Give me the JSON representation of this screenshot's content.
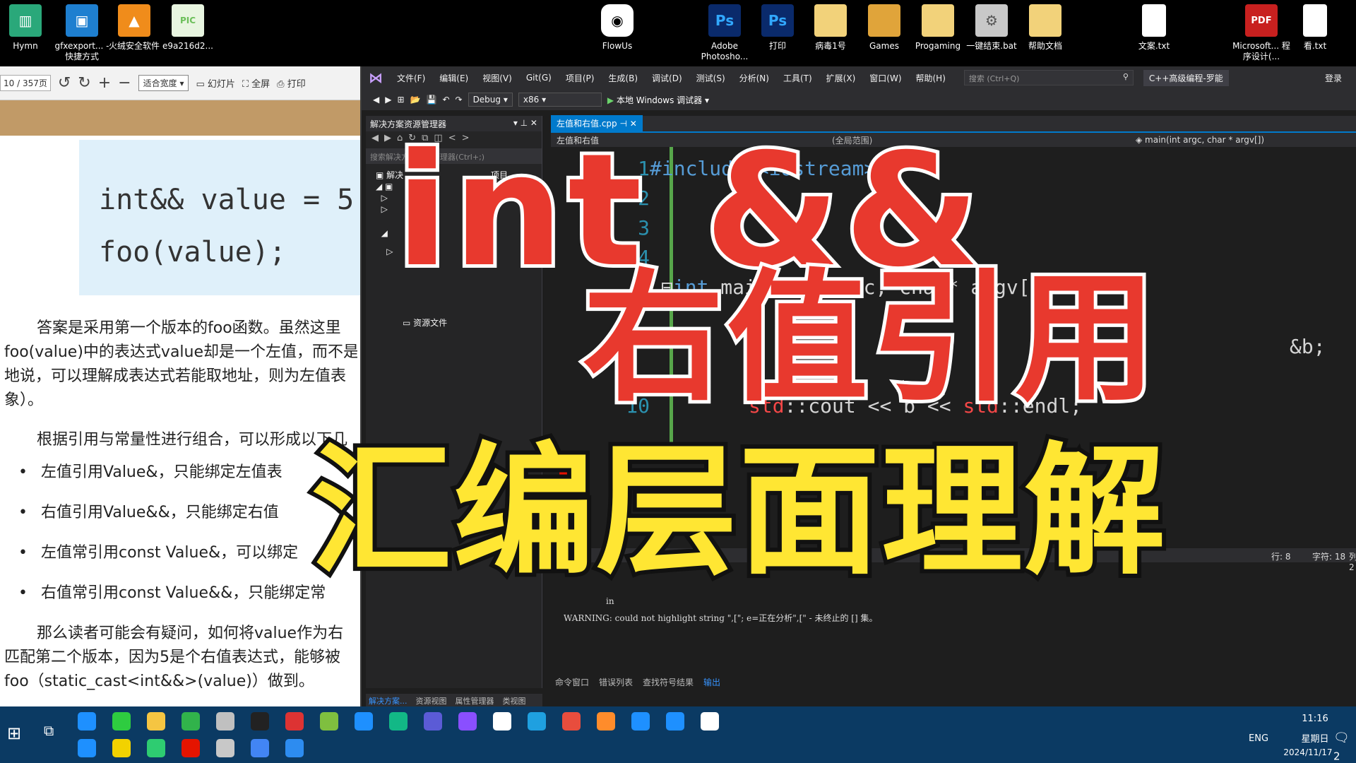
{
  "desktop": {
    "icons": [
      {
        "label": "Hymn",
        "color": "#2aa87a"
      },
      {
        "label": "gfxexport... - 快捷方式",
        "color": "#1e7fd0"
      },
      {
        "label": "火绒安全软件",
        "color": "#f08c1b"
      },
      {
        "label": "e9a216d2...",
        "color": "#6bbf59"
      },
      {
        "label": "FlowUs",
        "color": "#ffffff"
      },
      {
        "label": "Adobe Photosho...",
        "color": "#0a2a6b"
      },
      {
        "label": "打印",
        "color": "#0a2a6b"
      },
      {
        "label": "病毒1号",
        "color": "#f2d27a"
      },
      {
        "label": "Games",
        "color": "#e0a43a"
      },
      {
        "label": "Progaming",
        "color": "#f2d27a"
      },
      {
        "label": "一键结束.bat",
        "color": "#c8c8c8"
      },
      {
        "label": "帮助文档",
        "color": "#f2d27a"
      },
      {
        "label": "文案.txt",
        "color": "#ffffff"
      },
      {
        "label": "Microsoft... 程序设计(...",
        "color": "#c8201f"
      },
      {
        "label": "看.txt",
        "color": "#ffffff"
      }
    ],
    "ps_text": "Ps",
    "pdf_badge": "PDF",
    "pic_badge": "PIC"
  },
  "pdf_reader": {
    "page_indicator": "10 / 357页",
    "zoom": "适合宽度",
    "slideshow": "幻灯片",
    "fullscreen": "全屏",
    "print": "打印",
    "code_line1": "int&& value = 5",
    "code_line2": "foo(value);",
    "para1_l1": "答案是采用第一个版本的foo函数。虽然这里",
    "para1_l2": "foo(value)中的表达式value却是一个左值，而不是",
    "para1_l3": "地说，可以理解成表达式若能取地址，则为左值表",
    "para1_l4": "象）。",
    "para2": "根据引用与常量性进行组合，可以形成以下几",
    "bullets": [
      "左值引用Value&，只能绑定左值表",
      "右值引用Value&&，只能绑定右值",
      "左值常引用const Value&，可以绑定",
      "右值常引用const Value&&，只能绑定常"
    ],
    "para3_l1": "那么读者可能会有疑问，如何将value作为右",
    "para3_l2": "匹配第二个版本，因为5是个右值表达式，能够被",
    "para3_l3": "foo（static_cast<int&&>(value)）做到。"
  },
  "vs": {
    "menus": [
      "文件(F)",
      "编辑(E)",
      "视图(V)",
      "Git(G)",
      "项目(P)",
      "生成(B)",
      "调试(D)",
      "测试(S)",
      "分析(N)",
      "工具(T)",
      "扩展(X)",
      "窗口(W)",
      "帮助(H)"
    ],
    "search_placeholder": "搜索 (Ctrl+Q)",
    "project_title": "C++高级编程-罗能",
    "login": "登录",
    "config": "Debug",
    "platform": "x86",
    "run_label": "本地 Windows 调试器",
    "solution_title": "解决方案资源管理器",
    "solution_search": "搜索解决方案资源管理器(Ctrl+;)",
    "solution_root": "解决",
    "solution_suffix": "项目",
    "resource_files": "资源文件",
    "solution_tabs": [
      "解决方案...",
      "资源视图",
      "属性管理器",
      "类视图"
    ],
    "editor_tab": "左值和右值.cpp",
    "nav_file": "左值和右值",
    "nav_scope": "(全局范围)",
    "nav_func": "main(int argc, char * argv[])",
    "line_numbers": [
      "1",
      "2",
      "3",
      "4",
      "5",
      "10"
    ],
    "code_line1": "#include <iostream>",
    "code_line5_kw": "int",
    "code_line5_rest": " main(int argc, char* argv[])",
    "code_line_b": "&b;",
    "code_line10_a": "std",
    "code_line10_b": "::cout << b << ",
    "code_line10_c": "std",
    "code_line10_d": "::endl;",
    "status_line": "行: 8",
    "status_char": "字符: 18",
    "status_col": "列: 2",
    "output_label": "in",
    "output_warning": "WARNING: could not highlight string \",[\"; e=正在分析\",[\" - 未终止的 [] 集。",
    "output_tabs": [
      "命令窗口",
      "错误列表",
      "查找符号结果",
      "输出"
    ]
  },
  "overlay": {
    "line1": "int &&",
    "line2": "右值引用",
    "line3": "汇编层面理解"
  },
  "taskbar": {
    "lang": "ENG",
    "time": "11:16",
    "weekday": "星期日",
    "date": "2024/11/17",
    "notifications": "2",
    "app_colors": [
      "#1e90ff",
      "#2ecc40",
      "#f5c542",
      "#31b34b",
      "#c0c0c0",
      "#222222",
      "#d33",
      "#7fbf3f",
      "#1e90ff",
      "#12b886",
      "#5b5bd6",
      "#8a4fff",
      "#ffffff",
      "#1fa0e0",
      "#e84d3d",
      "#ff8c2b",
      "#1e90ff",
      "#1e90ff",
      "#ffffff",
      "#1e90ff",
      "#f2d200",
      "#2ecc71",
      "#e51400",
      "#c8c8c8",
      "#4285f4",
      "#2d8cf0"
    ]
  }
}
